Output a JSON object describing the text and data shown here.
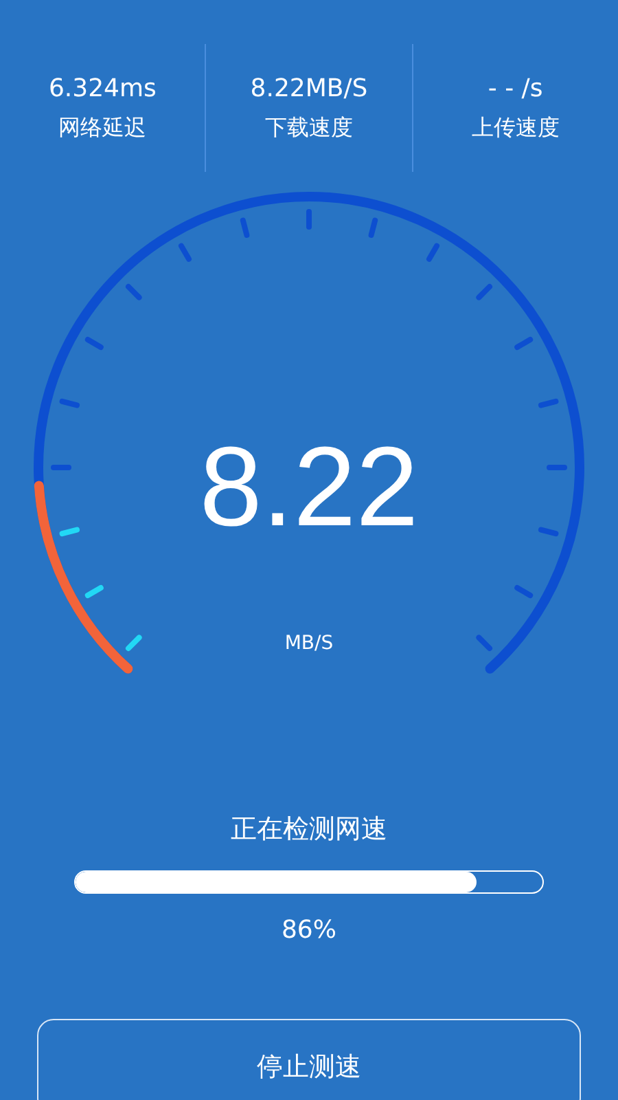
{
  "stats": [
    {
      "value": "6.324ms",
      "label": "网络延迟"
    },
    {
      "value": "8.22MB/S",
      "label": "下载速度"
    },
    {
      "value": "- - /s",
      "label": "上传速度"
    }
  ],
  "gauge": {
    "reading": "8.22",
    "unit": "MB/S",
    "level": 0.16
  },
  "status": "正在检测网速",
  "progress": {
    "level": 0.86,
    "reading": "86%"
  },
  "button": "停止测速"
}
